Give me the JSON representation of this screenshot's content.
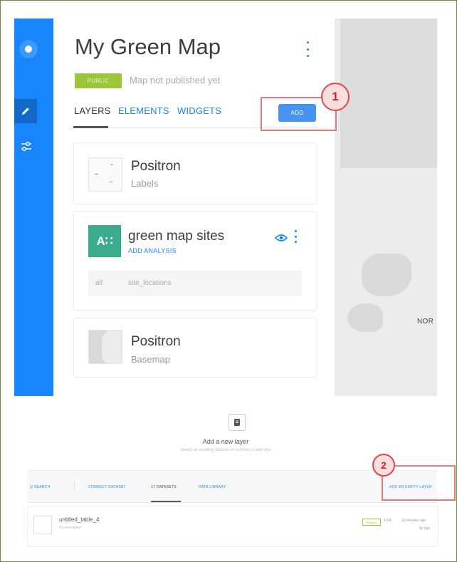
{
  "map": {
    "title": "My Green Map",
    "privacy_badge": "PUBLIC",
    "publish_status": "Map not published yet"
  },
  "tabs": [
    "LAYERS",
    "ELEMENTS",
    "WIDGETS"
  ],
  "active_tab": "LAYERS",
  "add_button": "ADD",
  "layers": [
    {
      "name": "Positron",
      "subtitle": "Labels"
    },
    {
      "name": "green map sites",
      "icon_text": "A∷",
      "action": "ADD ANALYSIS",
      "source_prefix": "all",
      "source": "site_locations"
    },
    {
      "name": "Positron",
      "subtitle": "Basemap"
    }
  ],
  "map_preview": {
    "label": "NOR"
  },
  "callouts": [
    "1",
    "2"
  ],
  "add_layer_dialog": {
    "title": "Add a new layer",
    "subtitle": "Select an existing dataset or connect a new one",
    "tabs": {
      "search": "Q SEARCH",
      "connect": "CONNECT DATASET",
      "datasets": "17 DATASETS",
      "library": "DATA LIBRARY",
      "empty_layer": "ADD AN EMPTY LAYER"
    },
    "dataset_row": {
      "name": "untitled_table_4",
      "description": "No description",
      "badge": "PUBLIC",
      "size": "1 KB",
      "updated": "33 minutes ago",
      "updated_by": "by ngo"
    }
  },
  "colors": {
    "accent": "#1785fb",
    "public_green": "#9bc63a",
    "dataset_teal": "#3aac8d",
    "highlight": "#e07a7a",
    "frame": "#6b8e3a"
  }
}
